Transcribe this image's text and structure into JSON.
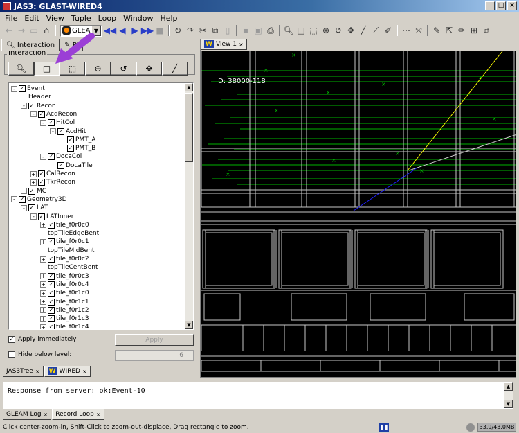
{
  "window": {
    "title": "JAS3: GLAST-WIRED4"
  },
  "menu": [
    "File",
    "Edit",
    "View",
    "Tuple",
    "Loop",
    "Window",
    "Help"
  ],
  "toolbar": {
    "combo_value": "GLEAM"
  },
  "left_panel": {
    "tabs": [
      "Interaction",
      "Pi"
    ],
    "group_label": "Interaction",
    "modes": [
      "magnifier",
      "rectangle-zoom",
      "ruler",
      "sphere-rotate",
      "rotate",
      "pan",
      "line"
    ],
    "selected_mode": "rectangle-zoom",
    "tree": [
      {
        "depth": 0,
        "exp": "-",
        "label": "Event"
      },
      {
        "depth": 1,
        "exp": "",
        "label": "Header",
        "nochk": true
      },
      {
        "depth": 1,
        "exp": "-",
        "label": "Recon"
      },
      {
        "depth": 2,
        "exp": "-",
        "label": "AcdRecon"
      },
      {
        "depth": 3,
        "exp": "-",
        "label": "HitCol"
      },
      {
        "depth": 4,
        "exp": "-",
        "label": "AcdHit"
      },
      {
        "depth": 5,
        "exp": "",
        "label": "PMT_A"
      },
      {
        "depth": 5,
        "exp": "",
        "label": "PMT_B"
      },
      {
        "depth": 3,
        "exp": "-",
        "label": "DocaCol"
      },
      {
        "depth": 4,
        "exp": "",
        "label": "DocaTile"
      },
      {
        "depth": 2,
        "exp": "+",
        "label": "CalRecon"
      },
      {
        "depth": 2,
        "exp": "+",
        "label": "TkrRecon"
      },
      {
        "depth": 1,
        "exp": "+",
        "label": "MC"
      },
      {
        "depth": 0,
        "exp": "-",
        "label": "Geometry3D"
      },
      {
        "depth": 1,
        "exp": "-",
        "label": "LAT"
      },
      {
        "depth": 2,
        "exp": "-",
        "label": "LATInner"
      },
      {
        "depth": 3,
        "exp": "+",
        "label": "tile_f0r0c0"
      },
      {
        "depth": 3,
        "exp": "",
        "label": "topTileEdgeBent",
        "nochk": true
      },
      {
        "depth": 3,
        "exp": "+",
        "label": "tile_f0r0c1"
      },
      {
        "depth": 3,
        "exp": "",
        "label": "topTileMidBent",
        "nochk": true
      },
      {
        "depth": 3,
        "exp": "+",
        "label": "tile_f0r0c2"
      },
      {
        "depth": 3,
        "exp": "",
        "label": "topTileCentBent",
        "nochk": true
      },
      {
        "depth": 3,
        "exp": "+",
        "label": "tile_f0r0c3"
      },
      {
        "depth": 3,
        "exp": "+",
        "label": "tile_f0r0c4"
      },
      {
        "depth": 3,
        "exp": "+",
        "label": "tile_f0r1c0"
      },
      {
        "depth": 3,
        "exp": "+",
        "label": "tile_f0r1c1"
      },
      {
        "depth": 3,
        "exp": "+",
        "label": "tile_f0r1c2"
      },
      {
        "depth": 3,
        "exp": "+",
        "label": "tile_f0r1c3"
      },
      {
        "depth": 3,
        "exp": "+",
        "label": "tile_f0r1c4"
      }
    ],
    "apply_immediately_label": "Apply immediately",
    "apply_button": "Apply",
    "hide_below_label": "Hide below level:",
    "hide_level_value": "6",
    "bottom_tabs": [
      "JAS3Tree",
      "WIRED"
    ]
  },
  "view": {
    "tab": "View 1",
    "event_label": "D: 38000-118",
    "colors": {
      "background": "#000000",
      "tracks": "#00b400",
      "frame": "#c8c8c8",
      "particle": "#ffff00",
      "fit": "#2020ff"
    }
  },
  "log": {
    "text": "Response from server: ok:Event-10",
    "tabs": [
      "GLEAM Log",
      "Record Loop"
    ]
  },
  "status": {
    "message": "Click center-zoom-in, Shift-Click to zoom-out-displace, Drag rectangle to zoom.",
    "memory": "33.9/43.0MB"
  }
}
